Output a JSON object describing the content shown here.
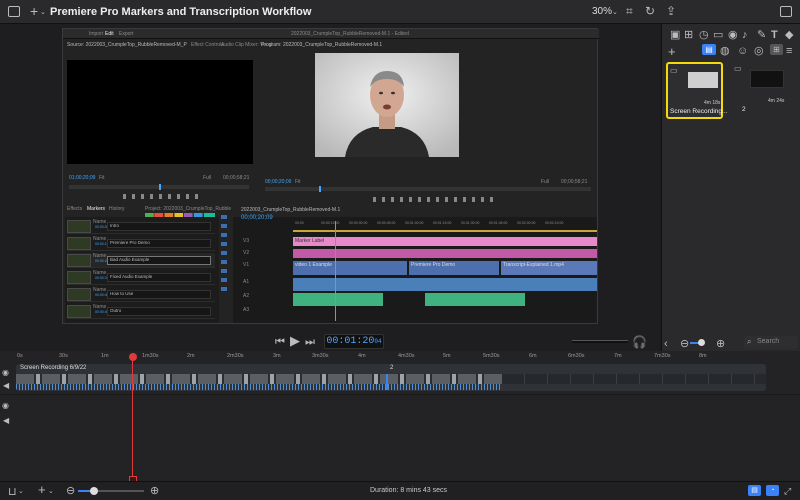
{
  "window": {
    "title": "Premiere Pro Markers and Transcription Workflow",
    "zoom": "30%"
  },
  "pp": {
    "menu": [
      "Import",
      "Edit",
      "Export"
    ],
    "doc": "2022003_CrumpleTop_RubbleRemoved-M.1 - Edited",
    "source_tab": "Source: 2022003_CrumpleTop_RubbleRemoved-M_PF: Markers Layer: 00:00:00:00",
    "effect_controls": "Effect Controls",
    "audio_mixer": "Audio Clip Mixer: Vocal",
    "program_tab": "Program: 2022003_CrumpleTop_RubbleRemoved-M.1",
    "src_time": "01;00;20;09",
    "src_fit": "Fit",
    "src_full": "Full",
    "src_dur": "00;00;58;21",
    "prg_time": "00;00;20;09",
    "prg_fit": "Fit",
    "prg_full": "Full",
    "prg_dur": "00;00;58;21",
    "panel_tabs": [
      "Effects",
      "Markers",
      "History",
      "Project: 2022003_CrumpleTop_RubbleRemoved-M.1"
    ],
    "markers": [
      {
        "label": "Name",
        "name": "Intro",
        "in": "00:00:02:10",
        "out": "00:00:13:00"
      },
      {
        "label": "Name",
        "name": "Premiere Pro Demo",
        "in": "00:00:13:01",
        "out": "00:00:22:07"
      },
      {
        "label": "Name",
        "name": "Bad Audio Example",
        "in": "00:00:22:08",
        "out": "00:00:31:13"
      },
      {
        "label": "Name",
        "name": "Fixed Audio Example",
        "in": "00:00:31:14",
        "out": "00:00:40:02"
      },
      {
        "label": "Name",
        "name": "How to Use",
        "in": "00:00:40:03",
        "out": "00:00:49:19"
      },
      {
        "label": "Name",
        "name": "Outro",
        "in": "00:00:49:20",
        "out": "00:00:57:06"
      }
    ],
    "tl_tab": "2022003_CrumpleTop_RubbleRemoved-M.1",
    "tl_time": "00;00;20;09",
    "tl_ticks": [
      "00:00",
      "00:00:15:00",
      "00:00:30:00",
      "00:00:45:00",
      "00:01:00:00",
      "00:01:15:00",
      "00:01:30:00",
      "00:01:45:00",
      "00:02:00:00",
      "00:02:15:00"
    ],
    "tracks": [
      "V3",
      "V2",
      "V1",
      "A1",
      "A2",
      "A3"
    ],
    "marker_clip": "Marker Label",
    "clip_names": [
      "video 1 Example",
      "Premiere Pro Demo",
      "Transcript-Explained 1.mp4"
    ]
  },
  "controls": {
    "timecode": "00:01:20",
    "frames": "04",
    "search_placeholder": "Search"
  },
  "ruler": [
    "0s",
    "30s",
    "1m",
    "1m30s",
    "2m",
    "2m30s",
    "3m",
    "3m30s",
    "4m",
    "4m30s",
    "5m",
    "5m30s",
    "6m",
    "6m30s",
    "7m",
    "7m30s",
    "8m"
  ],
  "timeline": {
    "clip": "Screen Recording 6/9/22",
    "second_marker": "2"
  },
  "right": {
    "items": [
      {
        "title": "Screen Recording...",
        "dur": "4m 18s",
        "selected": true
      },
      {
        "title": "2",
        "dur": "4m 24s",
        "selected": false
      }
    ]
  },
  "bottom": {
    "duration": "Duration: 8 mins 43 secs"
  },
  "colors": {
    "accent": "#3a82f7",
    "playhead": "#e03a3a",
    "selection": "#f5d90a"
  }
}
